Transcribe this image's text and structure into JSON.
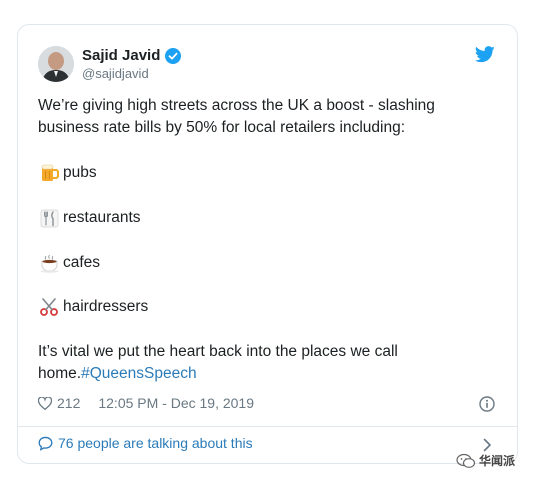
{
  "tweet": {
    "author_name": "Sajid Javid",
    "handle": "@sajidjavid",
    "intro": "We’re giving high streets across the UK a boost - slashing business rate bills by 50% for local retailers including:",
    "items": [
      {
        "icon": "beer-mug-icon",
        "label": "pubs"
      },
      {
        "icon": "fork-knife-icon",
        "label": "restaurants"
      },
      {
        "icon": "coffee-icon",
        "label": "cafes"
      },
      {
        "icon": "scissors-icon",
        "label": "hairdressers"
      }
    ],
    "closing_text": "It’s vital we put the heart back into the places we call home.",
    "hashtag": "#QueensSpeech",
    "likes": "212",
    "timestamp": "12:05 PM - Dec 19, 2019",
    "talking": "76 people are talking about this"
  },
  "watermark": {
    "text": "华闻派"
  },
  "colors": {
    "link": "#2b7bb9",
    "muted": "#697882",
    "twitter_blue": "#1da1f2",
    "border": "#e1e8ed"
  }
}
